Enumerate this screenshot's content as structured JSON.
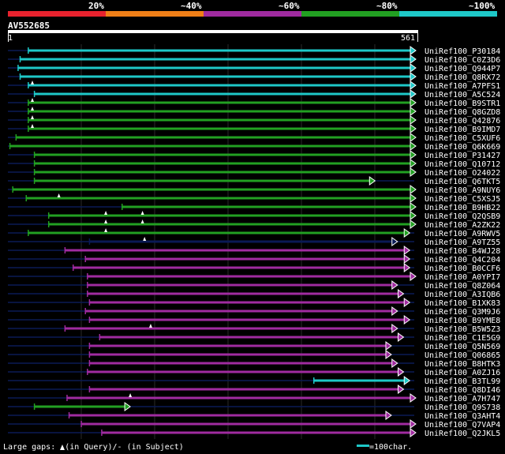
{
  "legend": {
    "labels": [
      "20%",
      "~40%",
      "~60%",
      "~80%",
      "~100%"
    ],
    "colors": [
      "#e8222e",
      "#f07f17",
      "#a02ba0",
      "#22a022",
      "#1ec8c8"
    ]
  },
  "query": {
    "name": "AV552685",
    "start": "1",
    "end": "561"
  },
  "colors": {
    "cyan": "#1ec8c8",
    "green": "#22a022",
    "magenta": "#a02ba0",
    "navy": "#0a1a55"
  },
  "hits": [
    {
      "id": "UniRef100_P30184",
      "color": "cyan",
      "start": 0.05,
      "end": 1.0,
      "marks": []
    },
    {
      "id": "UniRef100_C0Z3D6",
      "color": "cyan",
      "start": 0.03,
      "end": 1.0,
      "marks": []
    },
    {
      "id": "UniRef100_Q944P7",
      "color": "cyan",
      "start": 0.025,
      "end": 1.0,
      "marks": []
    },
    {
      "id": "UniRef100_Q8RX72",
      "color": "cyan",
      "start": 0.03,
      "end": 1.0,
      "marks": []
    },
    {
      "id": "UniRef100_A7PFS1",
      "color": "cyan",
      "start": 0.05,
      "end": 1.0,
      "marks": [
        0.06
      ]
    },
    {
      "id": "UniRef100_A5C524",
      "color": "cyan",
      "start": 0.065,
      "end": 1.0,
      "marks": []
    },
    {
      "id": "UniRef100_B9STR1",
      "color": "green",
      "start": 0.05,
      "end": 1.0,
      "marks": [
        0.06
      ]
    },
    {
      "id": "UniRef100_Q8GZD8",
      "color": "green",
      "start": 0.05,
      "end": 1.0,
      "marks": [
        0.06
      ]
    },
    {
      "id": "UniRef100_Q42876",
      "color": "green",
      "start": 0.05,
      "end": 1.0,
      "marks": [
        0.06
      ]
    },
    {
      "id": "UniRef100_B9IMD7",
      "color": "green",
      "start": 0.05,
      "end": 1.0,
      "marks": [
        0.06
      ]
    },
    {
      "id": "UniRef100_C5XUF6",
      "color": "green",
      "start": 0.02,
      "end": 1.0,
      "marks": []
    },
    {
      "id": "UniRef100_Q6K669",
      "color": "green",
      "start": 0.005,
      "end": 1.0,
      "marks": []
    },
    {
      "id": "UniRef100_P31427",
      "color": "green",
      "start": 0.065,
      "end": 1.0,
      "marks": []
    },
    {
      "id": "UniRef100_Q10712",
      "color": "green",
      "start": 0.065,
      "end": 1.0,
      "marks": []
    },
    {
      "id": "UniRef100_O24022",
      "color": "green",
      "start": 0.065,
      "end": 1.0,
      "marks": []
    },
    {
      "id": "UniRef100_Q6TKT5",
      "color": "green",
      "start": 0.065,
      "end": 0.9,
      "marks": []
    },
    {
      "id": "UniRef100_A9NUY6",
      "color": "green",
      "start": 0.012,
      "end": 1.0,
      "marks": []
    },
    {
      "id": "UniRef100_C5XSJ5",
      "color": "green",
      "start": 0.045,
      "end": 1.0,
      "marks": [
        0.125
      ]
    },
    {
      "id": "UniRef100_B9HB22",
      "color": "green",
      "start": 0.28,
      "end": 1.0,
      "marks": []
    },
    {
      "id": "UniRef100_Q2QSB9",
      "color": "green",
      "start": 0.1,
      "end": 1.0,
      "marks": [
        0.24,
        0.33
      ]
    },
    {
      "id": "UniRef100_A2ZK22",
      "color": "green",
      "start": 0.1,
      "end": 1.0,
      "marks": [
        0.24,
        0.33
      ]
    },
    {
      "id": "UniRef100_A9RWV5",
      "color": "green",
      "start": 0.05,
      "end": 0.985,
      "marks": [
        0.24
      ]
    },
    {
      "id": "UniRef100_A9TZ55",
      "color": "navy",
      "start": 0.2,
      "end": 0.955,
      "marks": [
        0.335
      ]
    },
    {
      "id": "UniRef100_B4WJ28",
      "color": "magenta",
      "start": 0.14,
      "end": 0.985,
      "marks": []
    },
    {
      "id": "UniRef100_Q4C204",
      "color": "magenta",
      "start": 0.19,
      "end": 0.985,
      "marks": []
    },
    {
      "id": "UniRef100_B0CCF6",
      "color": "magenta",
      "start": 0.16,
      "end": 0.985,
      "marks": []
    },
    {
      "id": "UniRef100_A0YPI7",
      "color": "magenta",
      "start": 0.195,
      "end": 1.0,
      "marks": []
    },
    {
      "id": "UniRef100_Q8Z064",
      "color": "magenta",
      "start": 0.195,
      "end": 0.955,
      "marks": []
    },
    {
      "id": "UniRef100_A3IQB6",
      "color": "magenta",
      "start": 0.195,
      "end": 0.97,
      "marks": []
    },
    {
      "id": "UniRef100_B1XK83",
      "color": "magenta",
      "start": 0.2,
      "end": 0.985,
      "marks": []
    },
    {
      "id": "UniRef100_Q3M9J6",
      "color": "magenta",
      "start": 0.19,
      "end": 0.955,
      "marks": []
    },
    {
      "id": "UniRef100_B9YME8",
      "color": "magenta",
      "start": 0.2,
      "end": 0.985,
      "marks": []
    },
    {
      "id": "UniRef100_B5W5Z3",
      "color": "magenta",
      "start": 0.14,
      "end": 0.955,
      "marks": [
        0.35
      ]
    },
    {
      "id": "UniRef100_C1E5G9",
      "color": "magenta",
      "start": 0.225,
      "end": 0.97,
      "marks": []
    },
    {
      "id": "UniRef100_Q5N569",
      "color": "magenta",
      "start": 0.2,
      "end": 0.94,
      "marks": []
    },
    {
      "id": "UniRef100_Q06865",
      "color": "magenta",
      "start": 0.2,
      "end": 0.94,
      "marks": []
    },
    {
      "id": "UniRef100_B8HTK3",
      "color": "magenta",
      "start": 0.2,
      "end": 0.955,
      "marks": []
    },
    {
      "id": "UniRef100_A0ZJ16",
      "color": "magenta",
      "start": 0.195,
      "end": 0.97,
      "marks": []
    },
    {
      "id": "UniRef100_B3TL99",
      "color": "cyan",
      "start": 0.75,
      "end": 0.985,
      "marks": []
    },
    {
      "id": "UniRef100_Q8DI46",
      "color": "magenta",
      "start": 0.2,
      "end": 0.97,
      "marks": []
    },
    {
      "id": "UniRef100_A7H747",
      "color": "magenta",
      "start": 0.145,
      "end": 1.0,
      "marks": [
        0.3
      ]
    },
    {
      "id": "UniRef100_Q9S738",
      "color": "green",
      "start": 0.065,
      "end": 0.3,
      "marks": []
    },
    {
      "id": "UniRef100_Q3AHT4",
      "color": "magenta",
      "start": 0.15,
      "end": 0.94,
      "marks": []
    },
    {
      "id": "UniRef100_Q7VAP4",
      "color": "magenta",
      "start": 0.18,
      "end": 1.0,
      "marks": []
    },
    {
      "id": "UniRef100_Q2JKL5",
      "color": "magenta",
      "start": 0.23,
      "end": 1.0,
      "marks": []
    }
  ],
  "footer": {
    "gaps_prefix": "Large gaps:",
    "gaps_query": "(in Query)/",
    "gaps_subject": "(in Subject)",
    "scale_label": "=100char."
  }
}
